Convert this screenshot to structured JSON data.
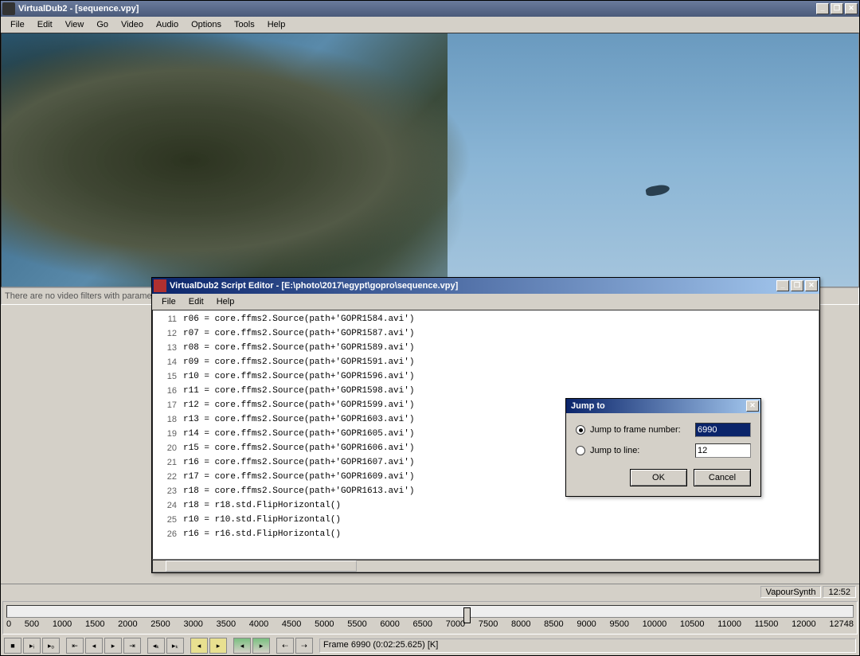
{
  "main": {
    "title": "VirtualDub2 - [sequence.vpy]",
    "menu": [
      "File",
      "Edit",
      "View",
      "Go",
      "Video",
      "Audio",
      "Options",
      "Tools",
      "Help"
    ],
    "filter_status": "There are no video filters with paramet",
    "status": {
      "engine": "VapourSynth",
      "time": "12:52"
    },
    "frame_info": "Frame 6990 (0:02:25.625) [K]",
    "ruler_max": "12748",
    "ruler_ticks": [
      "0",
      "500",
      "1000",
      "1500",
      "2000",
      "2500",
      "3000",
      "3500",
      "4000",
      "4500",
      "5000",
      "5500",
      "6000",
      "6500",
      "7000",
      "7500",
      "8000",
      "8500",
      "9000",
      "9500",
      "10000",
      "10500",
      "11000",
      "11500",
      "12000"
    ]
  },
  "script": {
    "title": "VirtualDub2 Script Editor - [E:\\photo\\2017\\egypt\\gopro\\sequence.vpy]",
    "menu": [
      "File",
      "Edit",
      "Help"
    ],
    "lines": [
      {
        "n": 11,
        "t": "r06 = core.ffms2.Source(path+'GOPR1584.avi')"
      },
      {
        "n": 12,
        "t": "r07 = core.ffms2.Source(path+'GOPR1587.avi')"
      },
      {
        "n": 13,
        "t": "r08 = core.ffms2.Source(path+'GOPR1589.avi')"
      },
      {
        "n": 14,
        "t": "r09 = core.ffms2.Source(path+'GOPR1591.avi')"
      },
      {
        "n": 15,
        "t": "r10 = core.ffms2.Source(path+'GOPR1596.avi')"
      },
      {
        "n": 16,
        "t": "r11 = core.ffms2.Source(path+'GOPR1598.avi')"
      },
      {
        "n": 17,
        "t": "r12 = core.ffms2.Source(path+'GOPR1599.avi')"
      },
      {
        "n": 18,
        "t": "r13 = core.ffms2.Source(path+'GOPR1603.avi')"
      },
      {
        "n": 19,
        "t": "r14 = core.ffms2.Source(path+'GOPR1605.avi')"
      },
      {
        "n": 20,
        "t": "r15 = core.ffms2.Source(path+'GOPR1606.avi')"
      },
      {
        "n": 21,
        "t": "r16 = core.ffms2.Source(path+'GOPR1607.avi')"
      },
      {
        "n": 22,
        "t": "r17 = core.ffms2.Source(path+'GOPR1609.avi')"
      },
      {
        "n": 23,
        "t": "r18 = core.ffms2.Source(path+'GOPR1613.avi')"
      },
      {
        "n": 24,
        "t": "r18 = r18.std.FlipHorizontal()"
      },
      {
        "n": 25,
        "t": "r10 = r10.std.FlipHorizontal()"
      },
      {
        "n": 26,
        "t": "r16 = r16.std.FlipHorizontal()"
      }
    ]
  },
  "jump": {
    "title": "Jump to",
    "opt_frame": "Jump to frame number:",
    "opt_line": "Jump to line:",
    "frame_value": "6990",
    "line_value": "12",
    "ok": "OK",
    "cancel": "Cancel"
  }
}
